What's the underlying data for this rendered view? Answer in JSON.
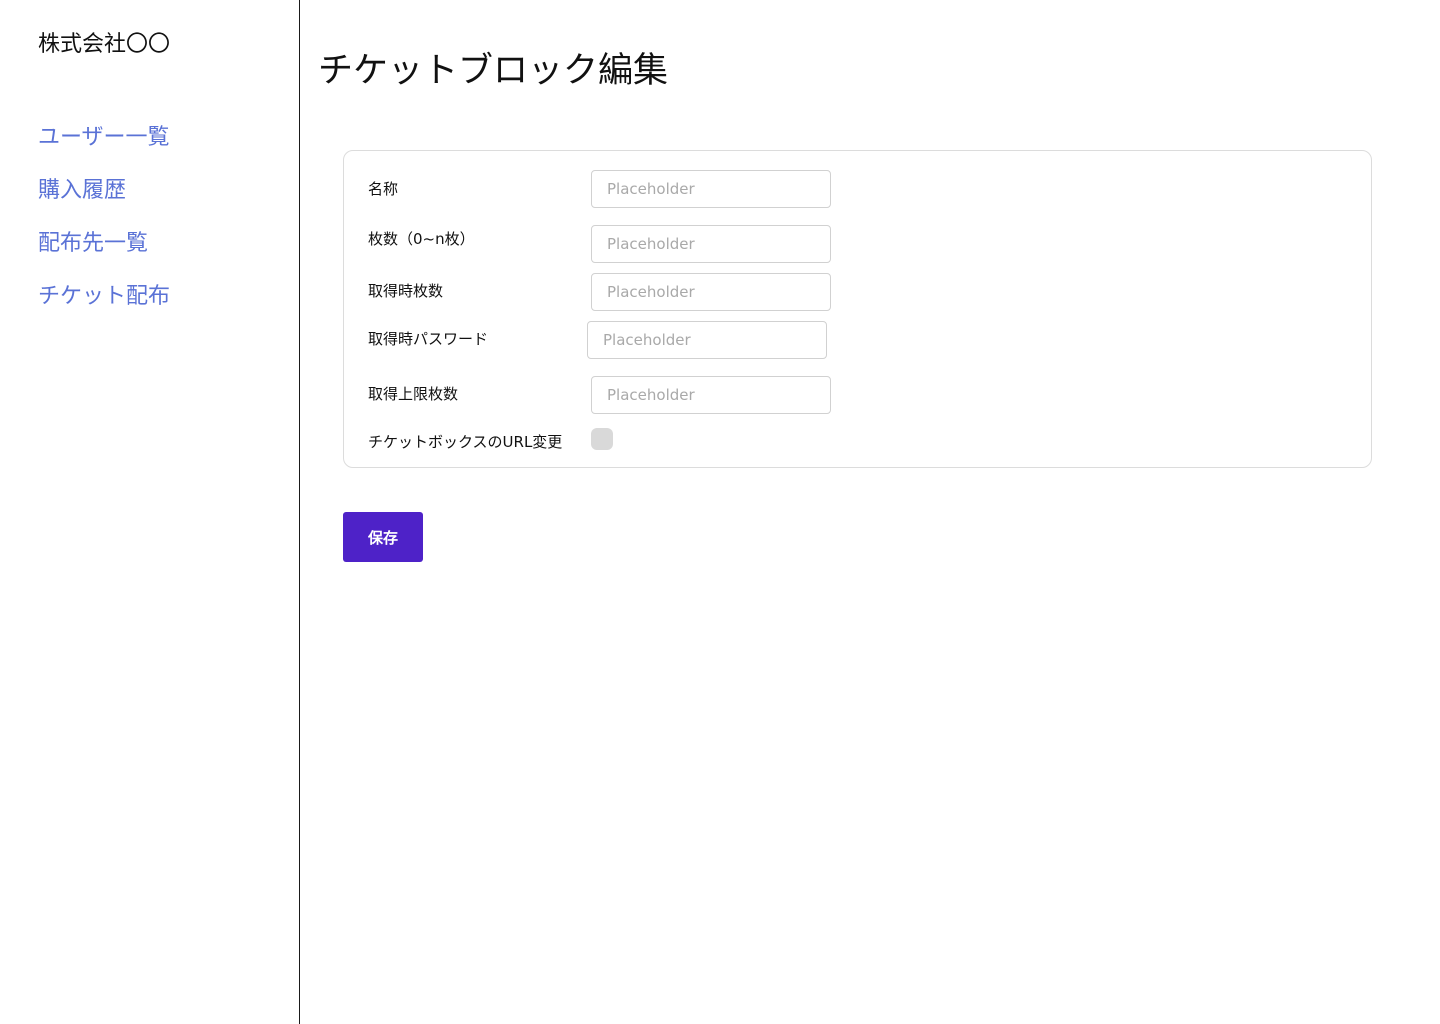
{
  "sidebar": {
    "company_name": "株式会社〇〇",
    "items": [
      {
        "label": "ユーザー一覧"
      },
      {
        "label": "購入履歴"
      },
      {
        "label": "配布先一覧"
      },
      {
        "label": "チケット配布"
      }
    ]
  },
  "main": {
    "title": "チケットブロック編集",
    "form": {
      "fields": [
        {
          "label": "名称",
          "placeholder": "Placeholder",
          "value": ""
        },
        {
          "label": "枚数（0~n枚）",
          "placeholder": "Placeholder",
          "value": ""
        },
        {
          "label": "取得時枚数",
          "placeholder": "Placeholder",
          "value": ""
        },
        {
          "label": "取得時パスワード",
          "placeholder": "Placeholder",
          "value": ""
        },
        {
          "label": "取得上限枚数",
          "placeholder": "Placeholder",
          "value": ""
        }
      ],
      "url_toggle": {
        "label": "チケットボックスのURL変更",
        "checked": false
      }
    },
    "save_label": "保存"
  },
  "colors": {
    "nav_link": "#5a72d6",
    "primary_button": "#4e22c8",
    "toggle_off": "#d9d9d9"
  }
}
